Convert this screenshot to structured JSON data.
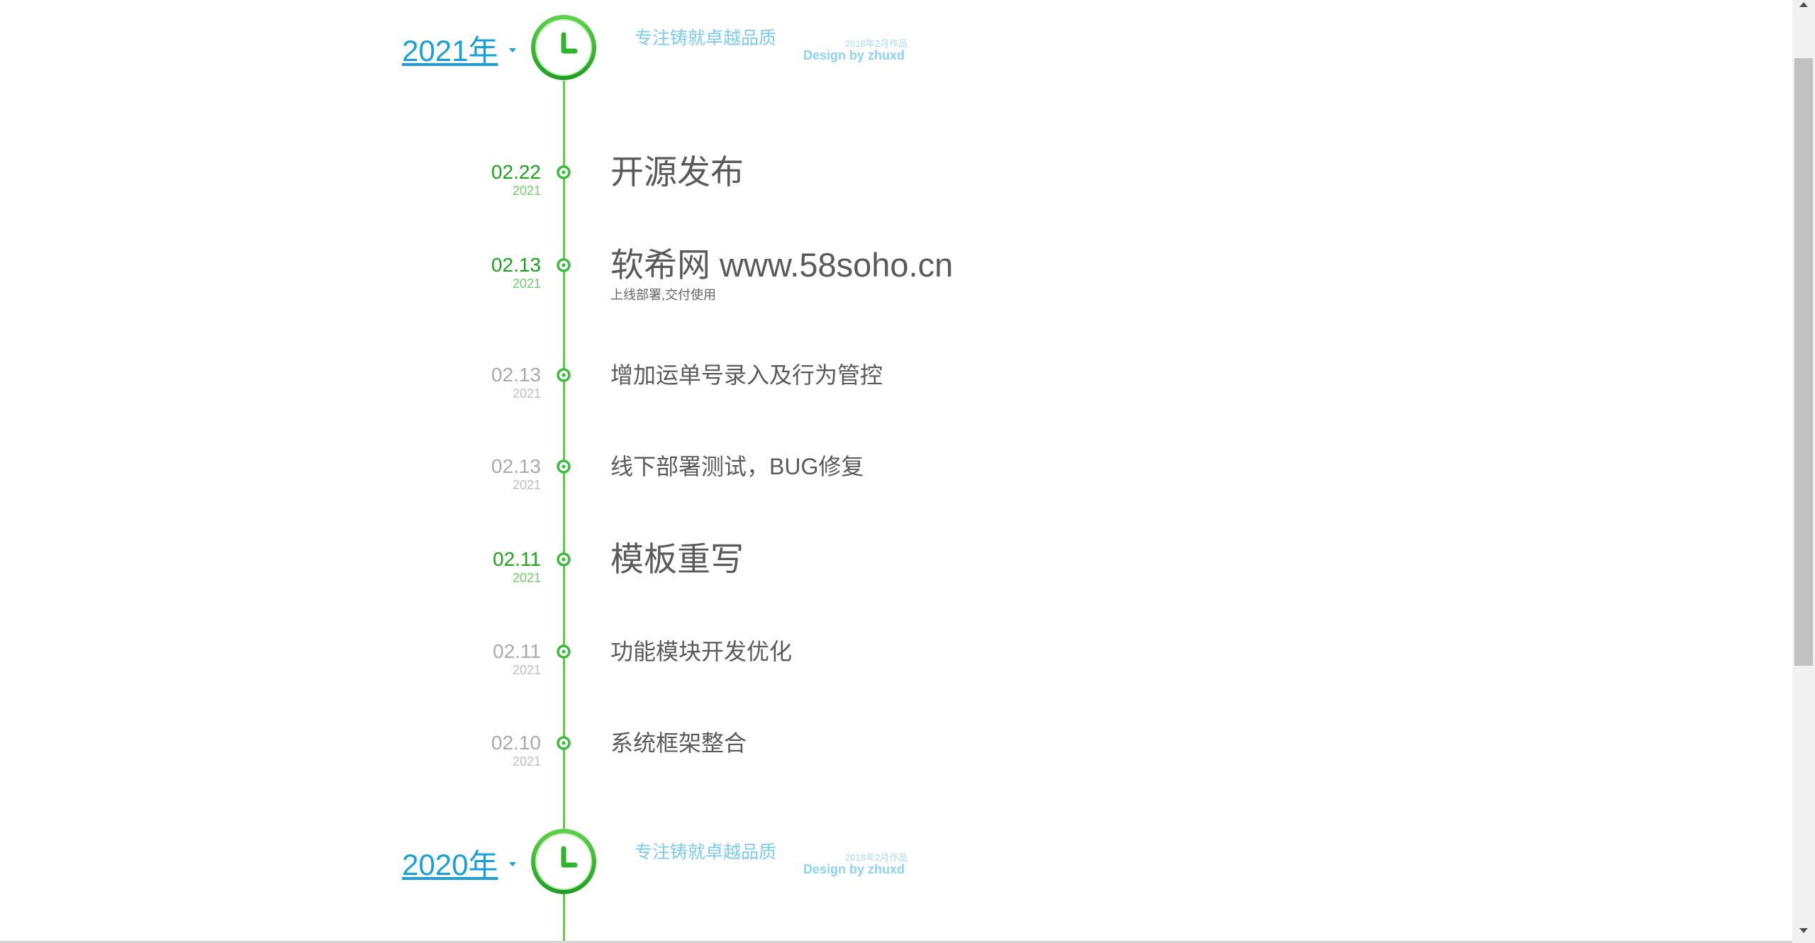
{
  "colors": {
    "timeline_green": "#66cc44",
    "date_highlight_green": "#1fa31f",
    "year_link_blue": "#1a9fd8",
    "slogan_blue": "#7ccbee",
    "muted_gray": "#aaaaaa",
    "title_gray": "#5a5a5a"
  },
  "icons": {
    "year_marker": "clock-icon",
    "year_toggle": "caret-down-icon",
    "event_marker": "ring-dot-icon"
  },
  "timeline": {
    "years": [
      {
        "year_label": "2021年",
        "slogan": "专注铸就卓越品质",
        "work_note": "2018年2月作品",
        "design_credit": "Design by zhuxd",
        "events": [
          {
            "date": "02.22",
            "year": "2021",
            "title": "开源发布"
          },
          {
            "date": "02.13",
            "year": "2021",
            "title": "软希网 www.58soho.cn",
            "subtitle": "上线部署,交付使用"
          },
          {
            "date": "02.13",
            "year": "2021",
            "title": "增加运单号录入及行为管控"
          },
          {
            "date": "02.13",
            "year": "2021",
            "title": "线下部署测试，BUG修复"
          },
          {
            "date": "02.11",
            "year": "2021",
            "title": "模板重写"
          },
          {
            "date": "02.11",
            "year": "2021",
            "title": "功能模块开发优化"
          },
          {
            "date": "02.10",
            "year": "2021",
            "title": "系统框架整合"
          }
        ]
      },
      {
        "year_label": "2020年",
        "slogan": "专注铸就卓越品质",
        "work_note": "2018年2月作品",
        "design_credit": "Design by zhuxd"
      }
    ]
  }
}
